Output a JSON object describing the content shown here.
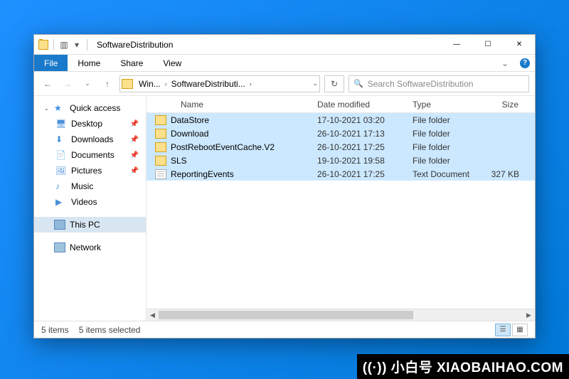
{
  "window": {
    "title": "SoftwareDistribution"
  },
  "ribbon": {
    "file": "File",
    "home": "Home",
    "share": "Share",
    "view": "View"
  },
  "address": {
    "seg1": "Win...",
    "seg2": "SoftwareDistributi...",
    "search_placeholder": "Search SoftwareDistribution"
  },
  "sidebar": {
    "quick_access": "Quick access",
    "desktop": "Desktop",
    "downloads": "Downloads",
    "documents": "Documents",
    "pictures": "Pictures",
    "music": "Music",
    "videos": "Videos",
    "this_pc": "This PC",
    "network": "Network"
  },
  "columns": {
    "name": "Name",
    "date": "Date modified",
    "type": "Type",
    "size": "Size"
  },
  "files": [
    {
      "name": "DataStore",
      "date": "17-10-2021 03:20",
      "type": "File folder",
      "size": "",
      "icon": "folder"
    },
    {
      "name": "Download",
      "date": "26-10-2021 17:13",
      "type": "File folder",
      "size": "",
      "icon": "folder"
    },
    {
      "name": "PostRebootEventCache.V2",
      "date": "26-10-2021 17:25",
      "type": "File folder",
      "size": "",
      "icon": "folder"
    },
    {
      "name": "SLS",
      "date": "19-10-2021 19:58",
      "type": "File folder",
      "size": "",
      "icon": "folder"
    },
    {
      "name": "ReportingEvents",
      "date": "26-10-2021 17:25",
      "type": "Text Document",
      "size": "327 KB",
      "icon": "doc"
    }
  ],
  "status": {
    "count": "5 items",
    "selected": "5 items selected"
  },
  "watermark": {
    "cn": "((·)) 小白号",
    "domain": "XIAOBAIHAO.COM"
  }
}
